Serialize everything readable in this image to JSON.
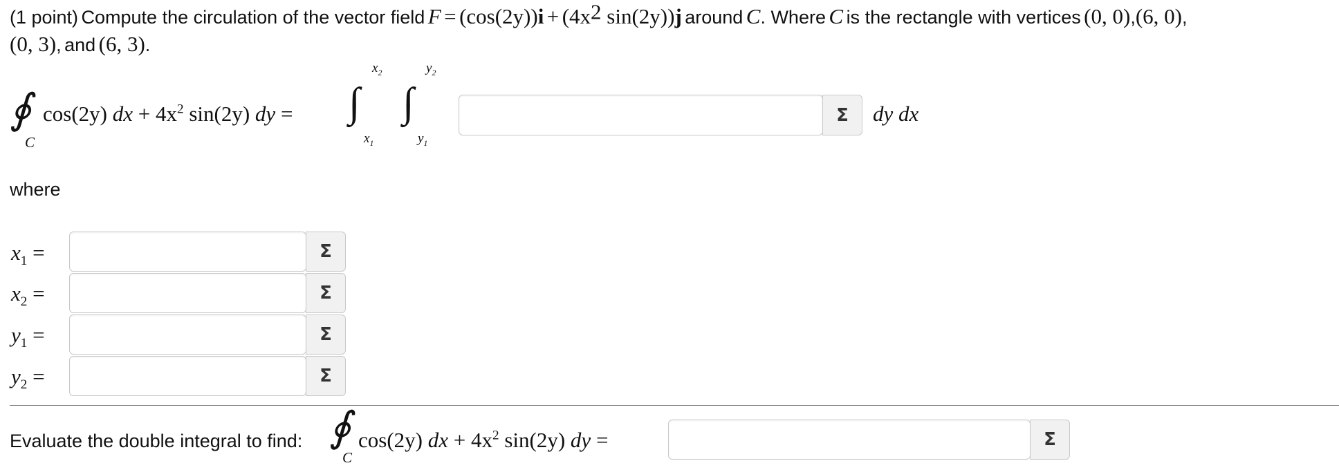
{
  "problem": {
    "points": "(1 point)",
    "intro": "Compute the circulation of the vector field",
    "field_lhs": "F",
    "eq": "=",
    "field_rhs_a": "(cos(2y))",
    "i_vec": "i",
    "plus": "+",
    "field_rhs_b1": "(4x",
    "field_rhs_b_exp": "2",
    "field_rhs_b2": " sin(2y))",
    "j_vec": "j",
    "around": "around",
    "curve": "C",
    "period_where": ". Where",
    "is_rect": "is the rectangle with vertices",
    "v1": "(0, 0)",
    "v2": "(6, 0)",
    "v3": "(0, 3)",
    "and": "and",
    "v4": "(6, 3)"
  },
  "integral_line": {
    "contour": "∮",
    "sub_c": "C",
    "integrand_a": "cos(2y)",
    "dx": "dx",
    "plus_4x": "+ 4x",
    "exp2": "2",
    "sin_part": " sin(2y)",
    "dy": "dy",
    "equals": "=",
    "int_sign": "∫",
    "x_upper": "x",
    "x_upper_sub": "2",
    "x_lower": "x",
    "x_lower_sub": "1",
    "y_upper": "y",
    "y_upper_sub": "2",
    "y_lower": "y",
    "y_lower_sub": "1",
    "integrand_input_value": "",
    "diff_label": "dy dx"
  },
  "where_label": "where",
  "bounds": [
    {
      "var": "x",
      "sub": "1",
      "eq": "=",
      "value": ""
    },
    {
      "var": "x",
      "sub": "2",
      "eq": "=",
      "value": ""
    },
    {
      "var": "y",
      "sub": "1",
      "eq": "=",
      "value": ""
    },
    {
      "var": "y",
      "sub": "2",
      "eq": "=",
      "value": ""
    }
  ],
  "evaluate": {
    "label": "Evaluate the double integral to find:",
    "answer_value": ""
  },
  "sigma_symbol": "Σ",
  "icons": {
    "equation_editor": "sigma-icon"
  }
}
